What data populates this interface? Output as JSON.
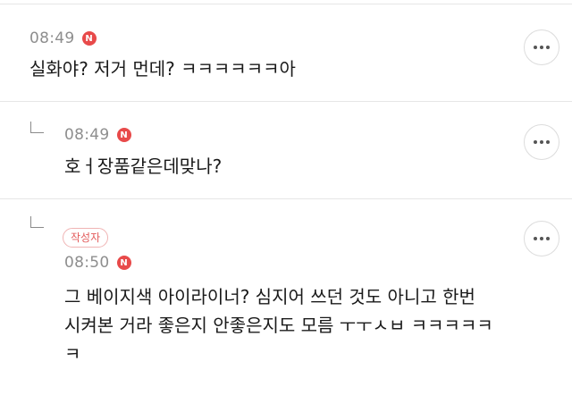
{
  "comments": [
    {
      "time": "08:49",
      "new_badge": "N",
      "text": "실화야? 저거 먼데? ㅋㅋㅋㅋㅋㅋ아"
    },
    {
      "time": "08:49",
      "new_badge": "N",
      "text": "호ㅓ장품같은데맞나?"
    },
    {
      "author_badge": "작성자",
      "time": "08:50",
      "new_badge": "N",
      "text_lines": [
        "그 베이지색 아이라이너? 심지어 쓰던 것도 아니고 한번",
        "시켜본 거라 좋은지 안좋은지도 모름 ㅜㅜㅅㅂ ㅋㅋㅋㅋㅋ",
        "ㅋ"
      ]
    }
  ],
  "icons": {
    "more": "more-horizontal-icon",
    "reply": "reply-arrow-icon"
  }
}
